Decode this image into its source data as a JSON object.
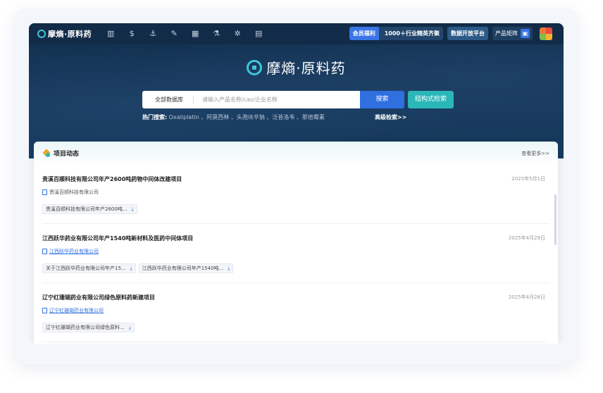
{
  "header": {
    "logo_text": "摩熵·原料药",
    "nav_icons": [
      "chart-icon",
      "dollar-icon",
      "anchor-icon",
      "edit-doc-icon",
      "calculator-icon",
      "flask-icon",
      "molecule-icon",
      "document-icon"
    ],
    "member_label": "会员福利",
    "member_promo": "1000＋行业精英齐聚",
    "open_platform": "数据开放平台",
    "product_matrix": "产品矩阵"
  },
  "hero": {
    "brand": "摩熵·原料药",
    "scope": "全部数据库",
    "search_placeholder": "请输入产品名称/cas/企业名称",
    "search_button": "搜索",
    "structure_button": "结构式检索",
    "hot_label": "热门搜索:",
    "hot_terms": "Oxaliplatin 、阿莫西林 、头孢呋辛钠 、泛昔洛韦 、那他霉素",
    "advanced": "高级检索>>"
  },
  "panel": {
    "title": "项目动态",
    "more": "查看更多>>",
    "items": [
      {
        "name": "贵溪百顺科技有限公司年产2600吨药物中间体改建项目",
        "date": "2025年5月1日",
        "company": "贵溪百顺科技有限公司",
        "files": [
          "贵溪百顺科技有限公司年产2600吨..."
        ]
      },
      {
        "name": "江西跃华药业有限公司年产1540吨新材料及医药中间体项目",
        "date": "2025年4月29日",
        "company": "江西跃华药业有限公司",
        "files": [
          "关于江西跃华药业有限公司年产15...",
          "江西跃华药业有限公司年产1540吨..."
        ]
      },
      {
        "name": "辽宁红珊瑚药业有限公司绿色原料药新建项目",
        "date": "2025年4月28日",
        "company": "辽宁红珊瑚药业有限公司",
        "files": [
          "辽宁红珊瑚药业有限公司绿色原料..."
        ]
      }
    ]
  }
}
